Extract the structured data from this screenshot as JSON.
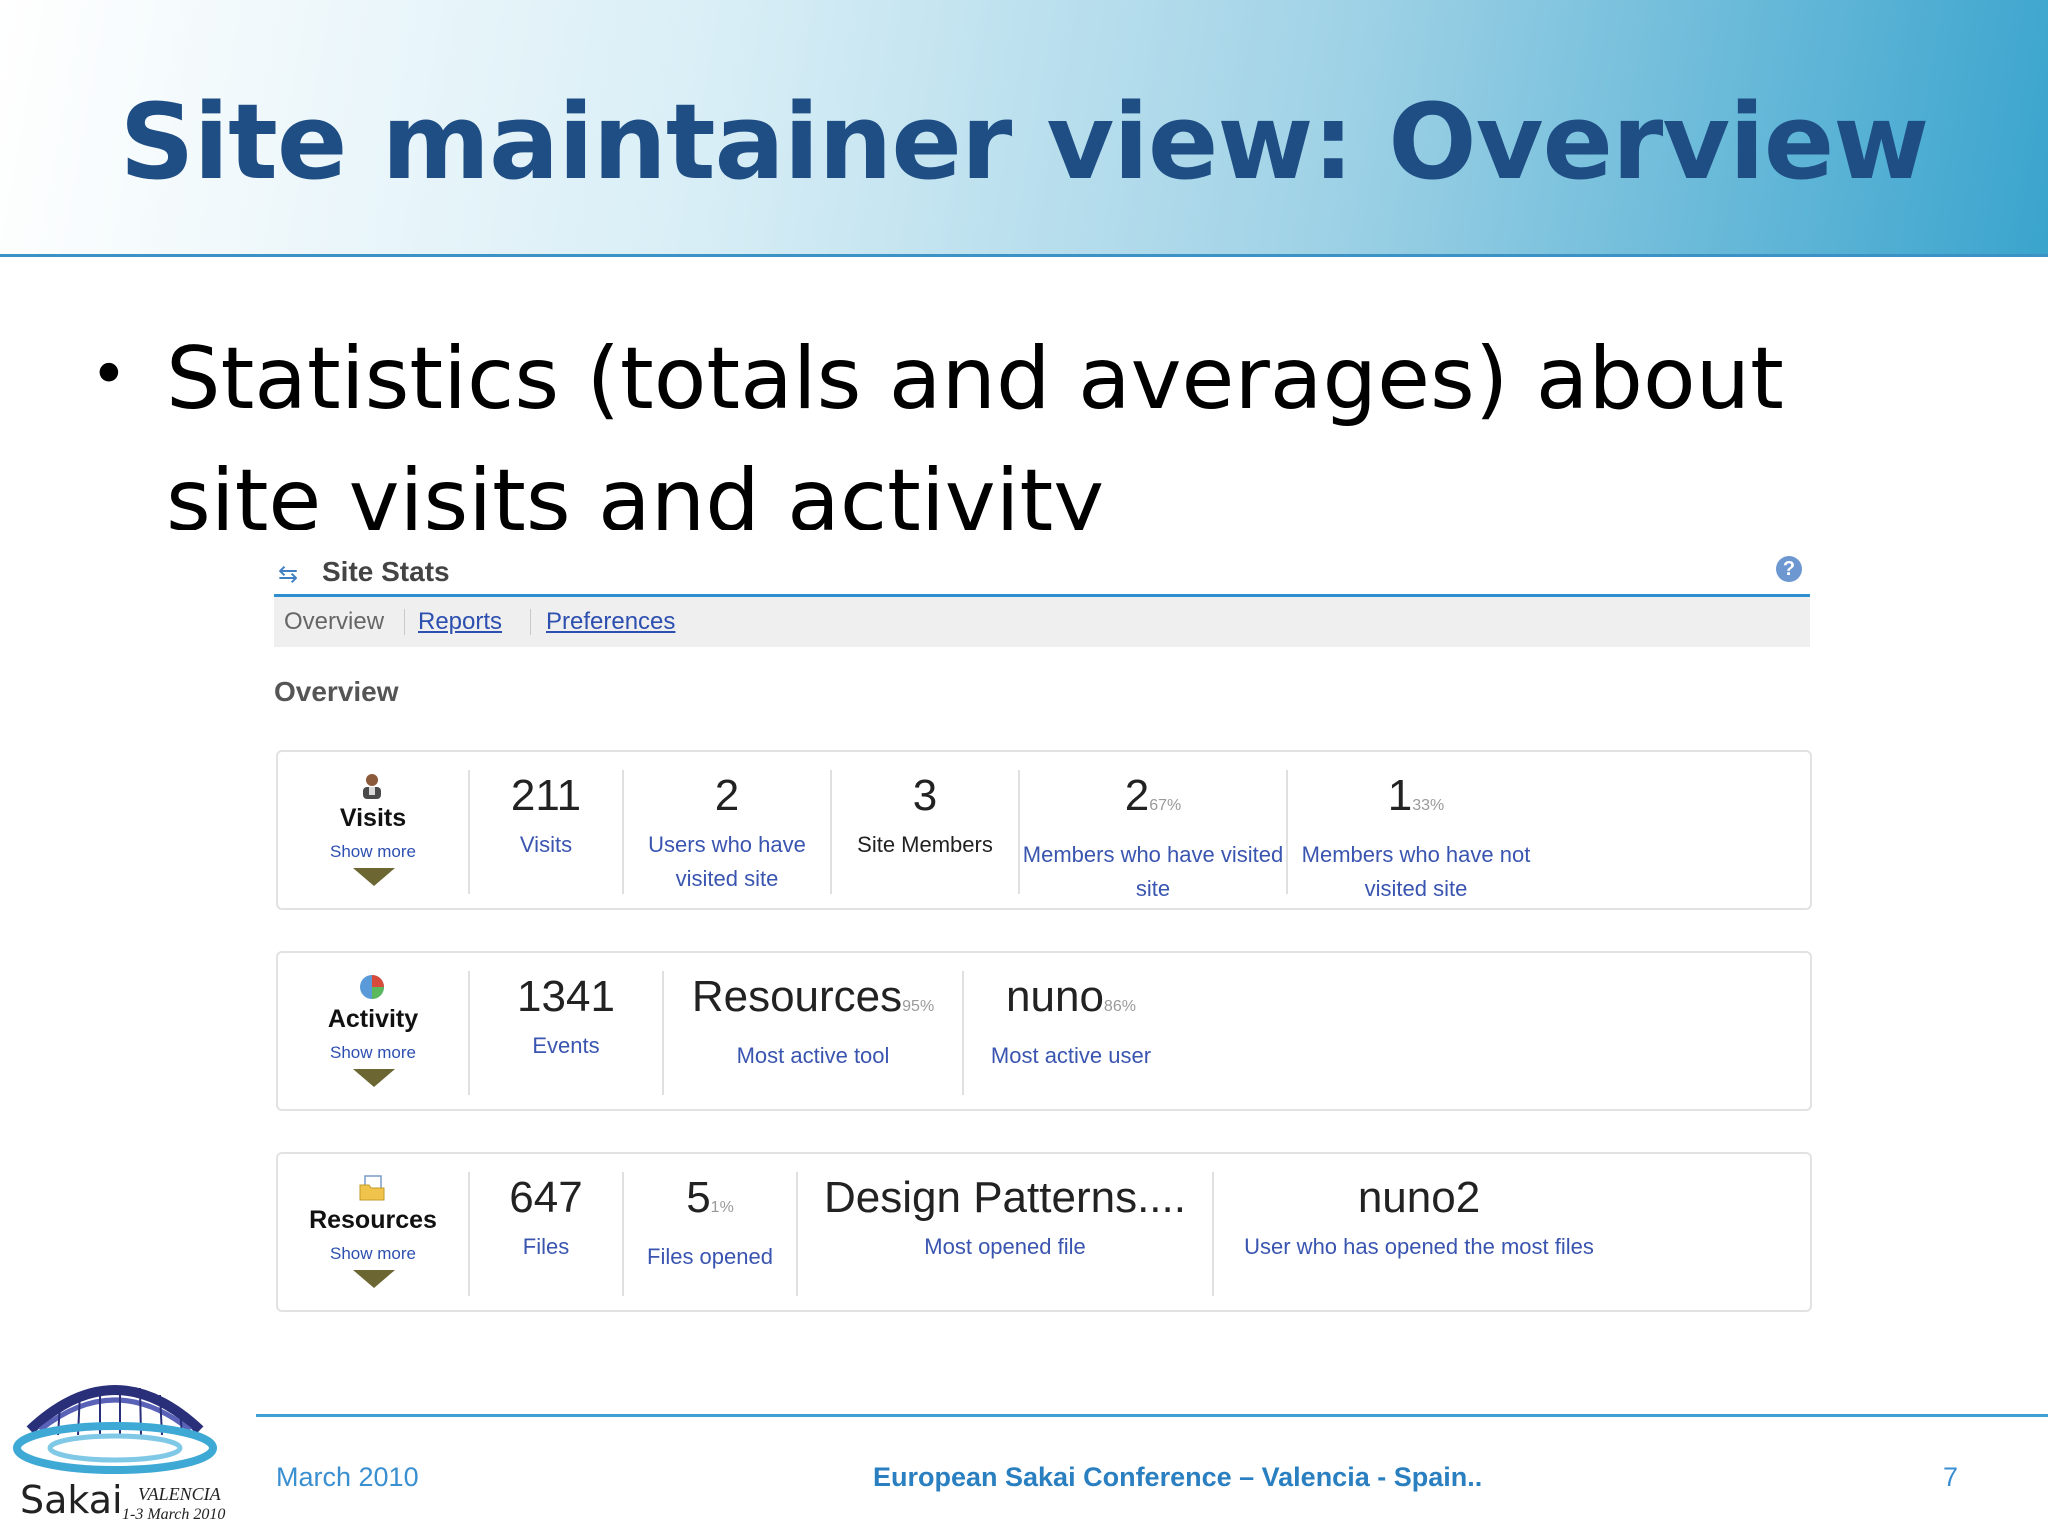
{
  "slide": {
    "title": "Site maintainer view: Overview",
    "bullet": "Statistics (totals and averages) about site visits and activity"
  },
  "tool": {
    "title": "Site Stats",
    "icon": "refresh-arrows-icon",
    "help_icon": "help-icon",
    "nav": {
      "current": "Overview",
      "reports": "Reports",
      "preferences": "Preferences"
    },
    "section_heading": "Overview"
  },
  "visits": {
    "title": "Visits",
    "icon": "user-icon",
    "show_more": "Show more",
    "stats": [
      {
        "value": "211",
        "pct": "",
        "label": "Visits"
      },
      {
        "value": "2",
        "pct": "",
        "label": "Users who have visited site"
      },
      {
        "value": "3",
        "pct": "",
        "label": "Site Members"
      },
      {
        "value": "2",
        "pct": "67%",
        "label": "Members who have visited site"
      },
      {
        "value": "1",
        "pct": "33%",
        "label": "Members who have not visited site"
      }
    ]
  },
  "activity": {
    "title": "Activity",
    "icon": "pie-chart-icon",
    "show_more": "Show more",
    "stats": [
      {
        "value": "1341",
        "pct": "",
        "label": "Events"
      },
      {
        "value": "Resources",
        "pct": "95%",
        "label": "Most active tool"
      },
      {
        "value": "nuno",
        "pct": "86%",
        "label": "Most active user"
      }
    ]
  },
  "resources": {
    "title": "Resources",
    "icon": "folder-icon",
    "show_more": "Show more",
    "stats": [
      {
        "value": "647",
        "pct": "",
        "label": "Files"
      },
      {
        "value": "5",
        "pct": "1%",
        "label": "Files opened"
      },
      {
        "value": "Design Patterns....",
        "pct": "",
        "label": "Most opened file"
      },
      {
        "value": "nuno2",
        "pct": "",
        "label": "User who has opened the most files"
      }
    ]
  },
  "footer": {
    "date": "March 2010",
    "conference": "European Sakai Conference – Valencia - Spain..",
    "page": "7"
  },
  "logo": {
    "word": "Sakai",
    "city": "VALENCIA",
    "dates": "1-3 March 2010"
  }
}
